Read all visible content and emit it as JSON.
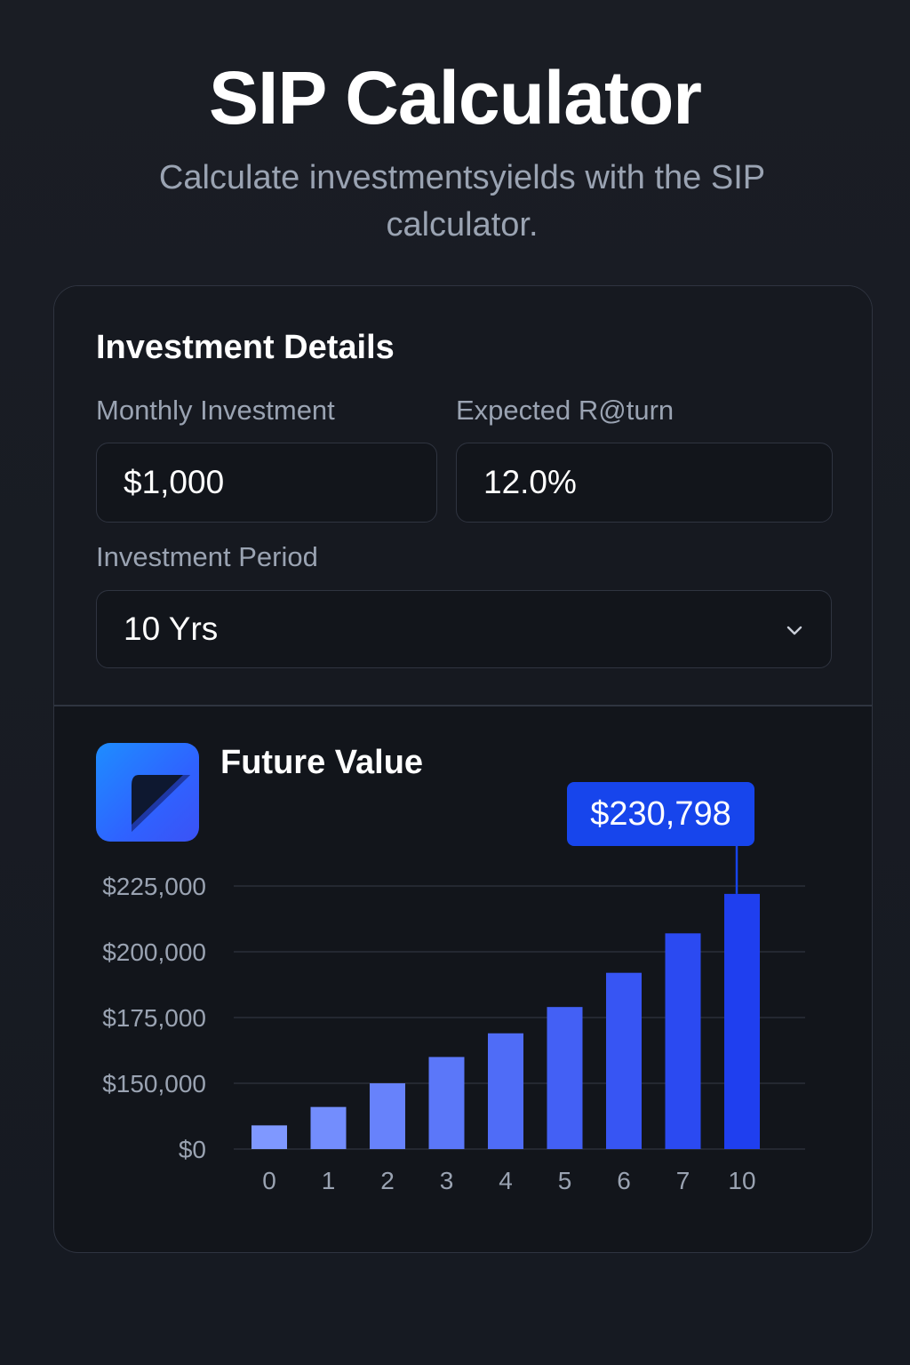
{
  "header": {
    "title": "SIP Calculator",
    "subtitle": "Calculate investmentsyields with the SIP calculator."
  },
  "details": {
    "section_title": "Investment Details",
    "monthly_label": "Monthly Investment",
    "monthly_value": "$1,000",
    "return_label": "Expected R@turn",
    "return_value": "12.0%",
    "period_label": "Investment Period",
    "period_value": "10 Yrs"
  },
  "result": {
    "title": "Future Value",
    "callout_value": "$230,798"
  },
  "colors": {
    "accent": "#1745ec",
    "bar_light": "#7f98ff",
    "bar_dark": "#1f3fef"
  },
  "chart_data": {
    "type": "bar",
    "categories": [
      "0",
      "1",
      "2",
      "3",
      "4",
      "5",
      "6",
      "7",
      "10"
    ],
    "values": [
      9000,
      16000,
      25000,
      35000,
      44000,
      54000,
      67000,
      82000,
      97000
    ],
    "y_tick_labels": [
      "$225,000",
      "$200,000",
      "$175,000",
      "$150,000",
      "$0"
    ],
    "y_tick_values": [
      100000,
      75000,
      50000,
      25000,
      0
    ],
    "ylim": [
      0,
      100000
    ],
    "grid": true,
    "highlight_index": 8
  }
}
